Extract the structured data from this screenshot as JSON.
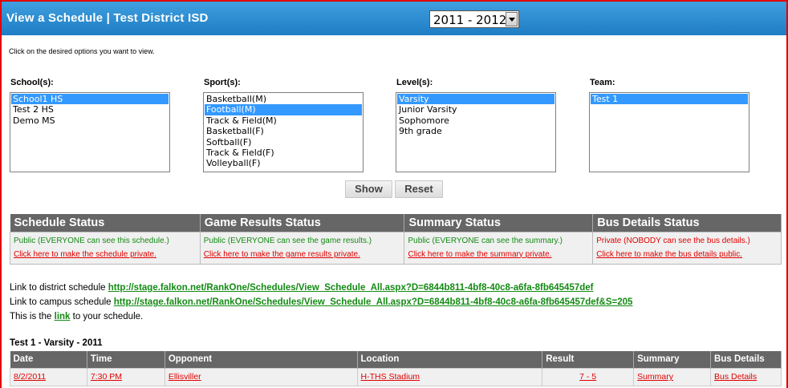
{
  "header": {
    "title": "View a Schedule | Test District ISD",
    "year_selected": "2011 - 2012"
  },
  "instructions": "Click on the desired options you want to view.",
  "filters": {
    "schools": {
      "label": "School(s):",
      "options": [
        "School1 HS",
        "Test 2 HS",
        "Demo MS"
      ],
      "selected": "School1 HS"
    },
    "sports": {
      "label": "Sport(s):",
      "options": [
        "Basketball(M)",
        "Football(M)",
        "Track & Field(M)",
        "Basketball(F)",
        "Softball(F)",
        "Track & Field(F)",
        "Volleyball(F)"
      ],
      "selected": "Football(M)"
    },
    "levels": {
      "label": "Level(s):",
      "options": [
        "Varsity",
        "Junior Varsity",
        "Sophomore",
        "9th grade"
      ],
      "selected": "Varsity"
    },
    "team": {
      "label": "Team:",
      "options": [
        "Test 1"
      ],
      "selected": "Test 1"
    }
  },
  "buttons": {
    "show": "Show",
    "reset": "Reset"
  },
  "status": {
    "headers": [
      "Schedule Status",
      "Game Results Status",
      "Summary Status",
      "Bus Details Status"
    ],
    "cells": [
      {
        "state": "Public (EVERYONE can see this schedule.)",
        "action": "Click here to make the schedule private.",
        "public": true
      },
      {
        "state": "Public (EVERYONE can see the game results.)",
        "action": "Click here to make the game results private.",
        "public": true
      },
      {
        "state": "Public (EVERYONE can see the summary.)",
        "action": "Click here to make the summary private.",
        "public": true
      },
      {
        "state": "Private (NOBODY can see the bus details.)",
        "action": "Click here to make the bus details public.",
        "public": false
      }
    ],
    "colors": {
      "public": "#138a13",
      "private": "#e00000"
    }
  },
  "links": {
    "district_prefix": "Link to district schedule",
    "district_url": "http://stage.falkon.net/RankOne/Schedules/View_Schedule_All.aspx?D=6844b811-4bf8-40c8-a6fa-8fb645457def",
    "campus_prefix": "Link to campus schedule",
    "campus_url": "http://stage.falkon.net/RankOne/Schedules/View_Schedule_All.aspx?D=6844b811-4bf8-40c8-a6fa-8fb645457def&S=205",
    "your_prefix": "This is the",
    "your_link": "link",
    "your_suffix": "to your schedule."
  },
  "schedule": {
    "title": "Test 1 - Varsity - 2011",
    "columns": [
      "Date",
      "Time",
      "Opponent",
      "Location",
      "Result",
      "Summary",
      "Bus Details"
    ],
    "rows": [
      {
        "date": "8/2/2011",
        "time": "7:30 PM",
        "opponent": "Ellisviller",
        "location": "H-THS Stadium",
        "result": "7 - 5",
        "summary": "Summary",
        "bus": "Bus Details"
      }
    ]
  }
}
